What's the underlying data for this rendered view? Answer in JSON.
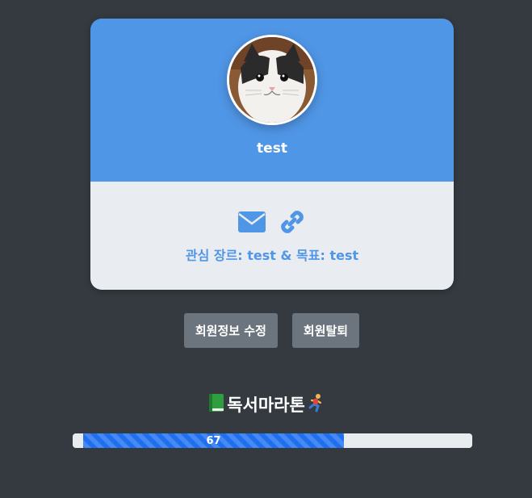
{
  "profile": {
    "username": "test",
    "interest_text": "관심 장르: test & 목표: test",
    "avatar_alt": "cat avatar",
    "icons": [
      {
        "name": "envelope-icon",
        "color": "#5096e6"
      },
      {
        "name": "link-icon",
        "color": "#5096e6"
      }
    ]
  },
  "actions": {
    "edit_label": "회원정보 수정",
    "withdraw_label": "회원탈퇴"
  },
  "marathon": {
    "title": "독서마라톤",
    "leading_icon": "green-book-icon",
    "trailing_icon": "runner-icon",
    "progress_value": 67,
    "progress_label": "67"
  },
  "colors": {
    "background": "#343a40",
    "card_header": "#5096e6",
    "card_body": "#e9ecf1",
    "button": "#6c757d",
    "progress_bar": "#1f6ff0"
  }
}
